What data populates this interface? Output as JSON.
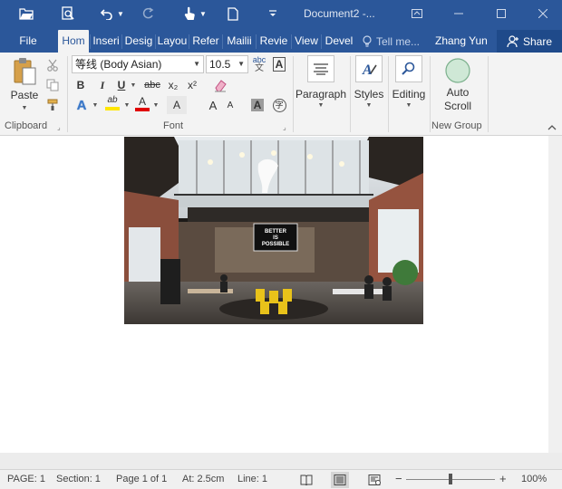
{
  "titlebar": {
    "doc_title": "Document2 -...",
    "user_name": "Zhang Yun",
    "share_label": "Share",
    "tell_me_placeholder": "Tell me..."
  },
  "tabs": [
    {
      "label": "File"
    },
    {
      "label": "Hom"
    },
    {
      "label": "Inseri"
    },
    {
      "label": "Desig"
    },
    {
      "label": "Layou"
    },
    {
      "label": "Refer"
    },
    {
      "label": "Mailii"
    },
    {
      "label": "Revie"
    },
    {
      "label": "View"
    },
    {
      "label": "Devel"
    }
  ],
  "ribbon": {
    "clipboard": {
      "label": "Clipboard",
      "paste_label": "Paste"
    },
    "font": {
      "label": "Font",
      "font_name": "等线 (Body Asian)",
      "font_size": "10.5",
      "bold": "B",
      "italic": "I",
      "underline": "U",
      "strikethrough": "abc",
      "subscript": "x₂",
      "superscript": "x²",
      "grow": "A",
      "shrink": "A",
      "highlight": "ab",
      "font_color": "A",
      "text_effects": "A",
      "char_shading": "A",
      "enclose": "字",
      "clear_format": "A",
      "phonetic": "abc",
      "border": "A"
    },
    "paragraph_label": "Paragraph",
    "styles_label": "Styles",
    "editing_label": "Editing",
    "new_group": {
      "label": "New Group",
      "auto_scroll_line1": "Auto",
      "auto_scroll_line2": "Scroll"
    }
  },
  "document": {
    "image_sign_text": [
      "BETTER",
      "IS",
      "POSSIBLE"
    ]
  },
  "statusbar": {
    "page": "PAGE: 1",
    "section": "Section: 1",
    "page_of": "Page 1 of 1",
    "at": "At: 2.5cm",
    "line": "Line: 1",
    "zoom_minus": "−",
    "zoom_plus": "+",
    "zoom": "100%"
  },
  "colors": {
    "brand": "#2b579a",
    "highlight_yellow": "#ffe600",
    "font_red": "#e00000"
  }
}
